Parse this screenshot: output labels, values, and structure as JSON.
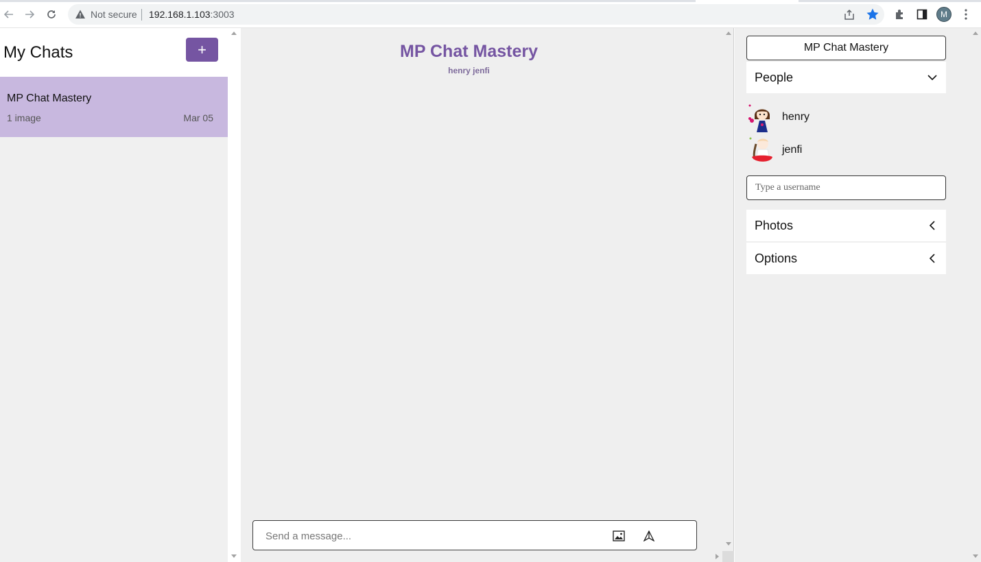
{
  "browser": {
    "security_label": "Not secure",
    "url_host": "192.168.1.103",
    "url_port": ":3003",
    "profile_initial": "M",
    "bookmark_color": "#1a73e8"
  },
  "left": {
    "heading": "My Chats",
    "new_chat_label": "+",
    "chats": [
      {
        "title": "MP Chat Mastery",
        "subtitle": "1 image",
        "date": "Mar 05"
      }
    ]
  },
  "chat": {
    "title": "MP Chat Mastery",
    "members": "henry jenfi",
    "input_placeholder": "Send a message..."
  },
  "settings": {
    "title": "MP Chat Mastery",
    "people_label": "People",
    "people": [
      {
        "name": "henry"
      },
      {
        "name": "jenfi"
      }
    ],
    "username_placeholder": "Type a username",
    "photos_label": "Photos",
    "options_label": "Options"
  },
  "colors": {
    "accent": "#7555a2",
    "selected_chat": "#c8b8df",
    "panel_bg": "#efefef"
  }
}
